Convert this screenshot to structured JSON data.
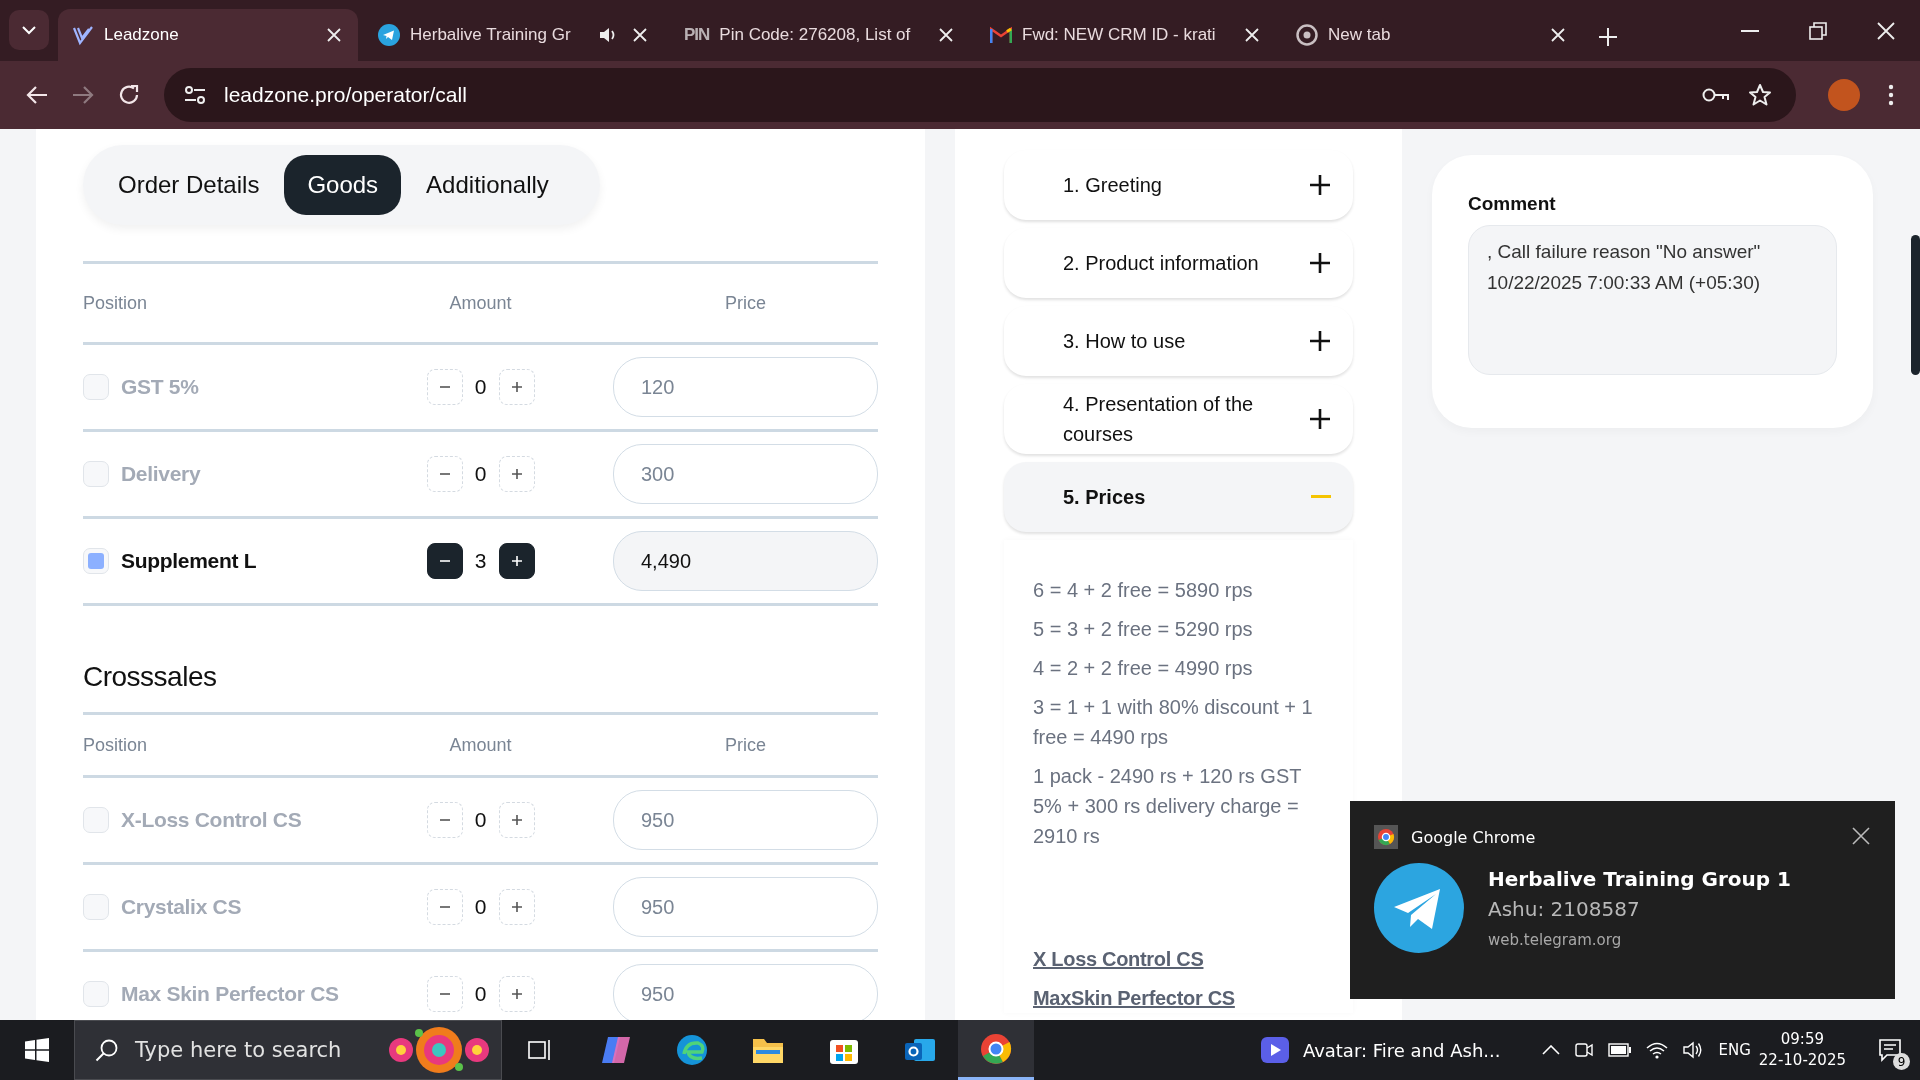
{
  "browser": {
    "tabs": [
      {
        "title": "Leadzone",
        "kind": "leadzone",
        "selected": true,
        "audible": false
      },
      {
        "title": "Herbalive Training Gr",
        "kind": "telegram",
        "selected": false,
        "audible": true
      },
      {
        "title": "Pin Code: 276208, List of",
        "kind": "pin",
        "favicon_text": "PIN",
        "selected": false,
        "audible": false
      },
      {
        "title": "Fwd: NEW CRM ID - krati",
        "kind": "gmail",
        "selected": false,
        "audible": false
      },
      {
        "title": "New tab",
        "kind": "chrome",
        "selected": false,
        "audible": false
      }
    ],
    "url": "leadzone.pro/operator/call"
  },
  "order": {
    "tabs": [
      {
        "label": "Order Details",
        "selected": false
      },
      {
        "label": "Goods",
        "selected": true
      },
      {
        "label": "Additionally",
        "selected": false
      }
    ],
    "goods": {
      "columns": [
        "Position",
        "Amount",
        "Price"
      ],
      "rows": [
        {
          "name": "GST 5%",
          "checked": false,
          "amount": "0",
          "price": "120"
        },
        {
          "name": "Delivery",
          "checked": false,
          "amount": "0",
          "price": "300"
        },
        {
          "name": "Supplement L",
          "checked": true,
          "amount": "3",
          "price": "4,490"
        }
      ]
    },
    "crosssales": {
      "title": "Crosssales",
      "columns": [
        "Position",
        "Amount",
        "Price"
      ],
      "rows": [
        {
          "name": "X-Loss Control CS",
          "checked": false,
          "amount": "0",
          "price": "950"
        },
        {
          "name": "Crystalix CS",
          "checked": false,
          "amount": "0",
          "price": "950"
        },
        {
          "name": "Max Skin Perfector CS",
          "checked": false,
          "amount": "0",
          "price": "950"
        }
      ]
    }
  },
  "script": {
    "sections": [
      {
        "label": "1. Greeting",
        "expanded": false
      },
      {
        "label": "2. Product information",
        "expanded": false
      },
      {
        "label": "3. How to use",
        "expanded": false
      },
      {
        "label": "4. Presentation of the courses",
        "expanded": false
      },
      {
        "label": "5. Prices",
        "expanded": true
      }
    ],
    "prices": [
      "6 = 4 + 2 free = 5890 rps",
      "5 = 3 + 2 free = 5290 rps",
      "4 = 2 + 2 free = 4990 rps",
      "3 = 1 + 1 with 80% discount + 1 free = 4490 rps",
      "1 pack - 2490 rs + 120 rs GST 5% + 300 rs delivery charge = 2910 rs"
    ],
    "links": [
      "X Loss Control CS",
      "MaxSkin Perfector CS"
    ]
  },
  "comment": {
    "label": "Comment",
    "value": ", Call failure reason \"No answer\"\n10/22/2025 7:00:33 AM (+05:30)"
  },
  "notification": {
    "app": "Google Chrome",
    "title": "Herbalive Training Group 1",
    "message": "Ashu: 2108587",
    "source": "web.telegram.org"
  },
  "taskbar": {
    "search_placeholder": "Type here to search",
    "apps": [
      {
        "kind": "task-view",
        "active": false
      },
      {
        "kind": "copilot",
        "active": false
      },
      {
        "kind": "edge",
        "active": false
      },
      {
        "kind": "folder",
        "active": false
      },
      {
        "kind": "store",
        "active": false
      },
      {
        "kind": "outlook",
        "active": false
      },
      {
        "kind": "chrome",
        "active": true
      }
    ],
    "media": "Avatar: Fire and Ash...",
    "language": "ENG",
    "time": "09:59",
    "date": "22-10-2025",
    "notification_count": "9"
  }
}
